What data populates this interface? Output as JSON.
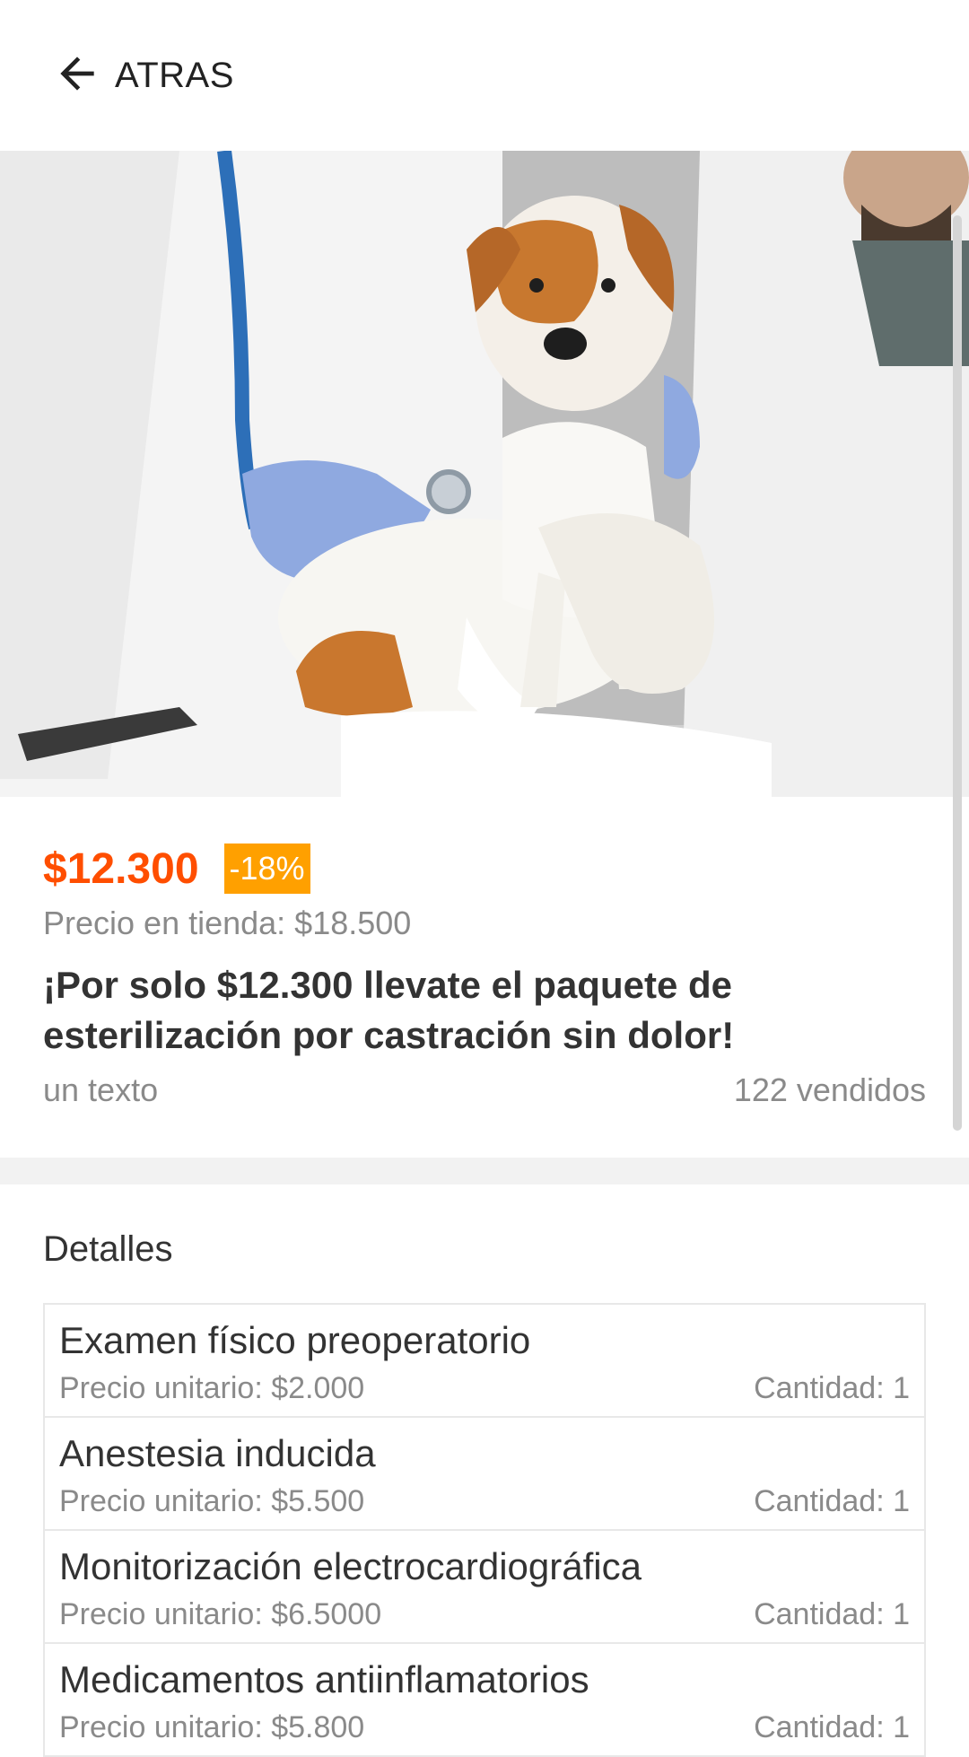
{
  "header": {
    "back_label": "ATRAS",
    "back_icon": "arrow-left-icon"
  },
  "hero": {
    "image": "veterinarians-examining-dog-photo"
  },
  "product": {
    "price": "$12.300",
    "discount": "-18%",
    "store_price": "Precio en tienda: $18.500",
    "title": "¡Por solo $12.300 llevate el paquete de esterilización por castración sin dolor!",
    "subtitle": "un texto",
    "sold": "122 vendidos"
  },
  "details": {
    "heading": "Detalles",
    "items": [
      {
        "name": "Examen físico preoperatorio",
        "unit_price": "Precio unitario: $2.000",
        "quantity": "Cantidad: 1"
      },
      {
        "name": "Anestesia inducida",
        "unit_price": "Precio unitario: $5.500",
        "quantity": "Cantidad: 1"
      },
      {
        "name": "Monitorización electrocardiográfica",
        "unit_price": "Precio unitario: $6.5000",
        "quantity": "Cantidad: 1"
      },
      {
        "name": "Medicamentos antiinflamatorios",
        "unit_price": "Precio unitario: $5.800",
        "quantity": "Cantidad: 1"
      }
    ]
  },
  "colors": {
    "price": "#ff4e00",
    "discount_bg": "#ffa000",
    "muted_text": "#8a8a8a",
    "divider": "#f2f2f2"
  }
}
